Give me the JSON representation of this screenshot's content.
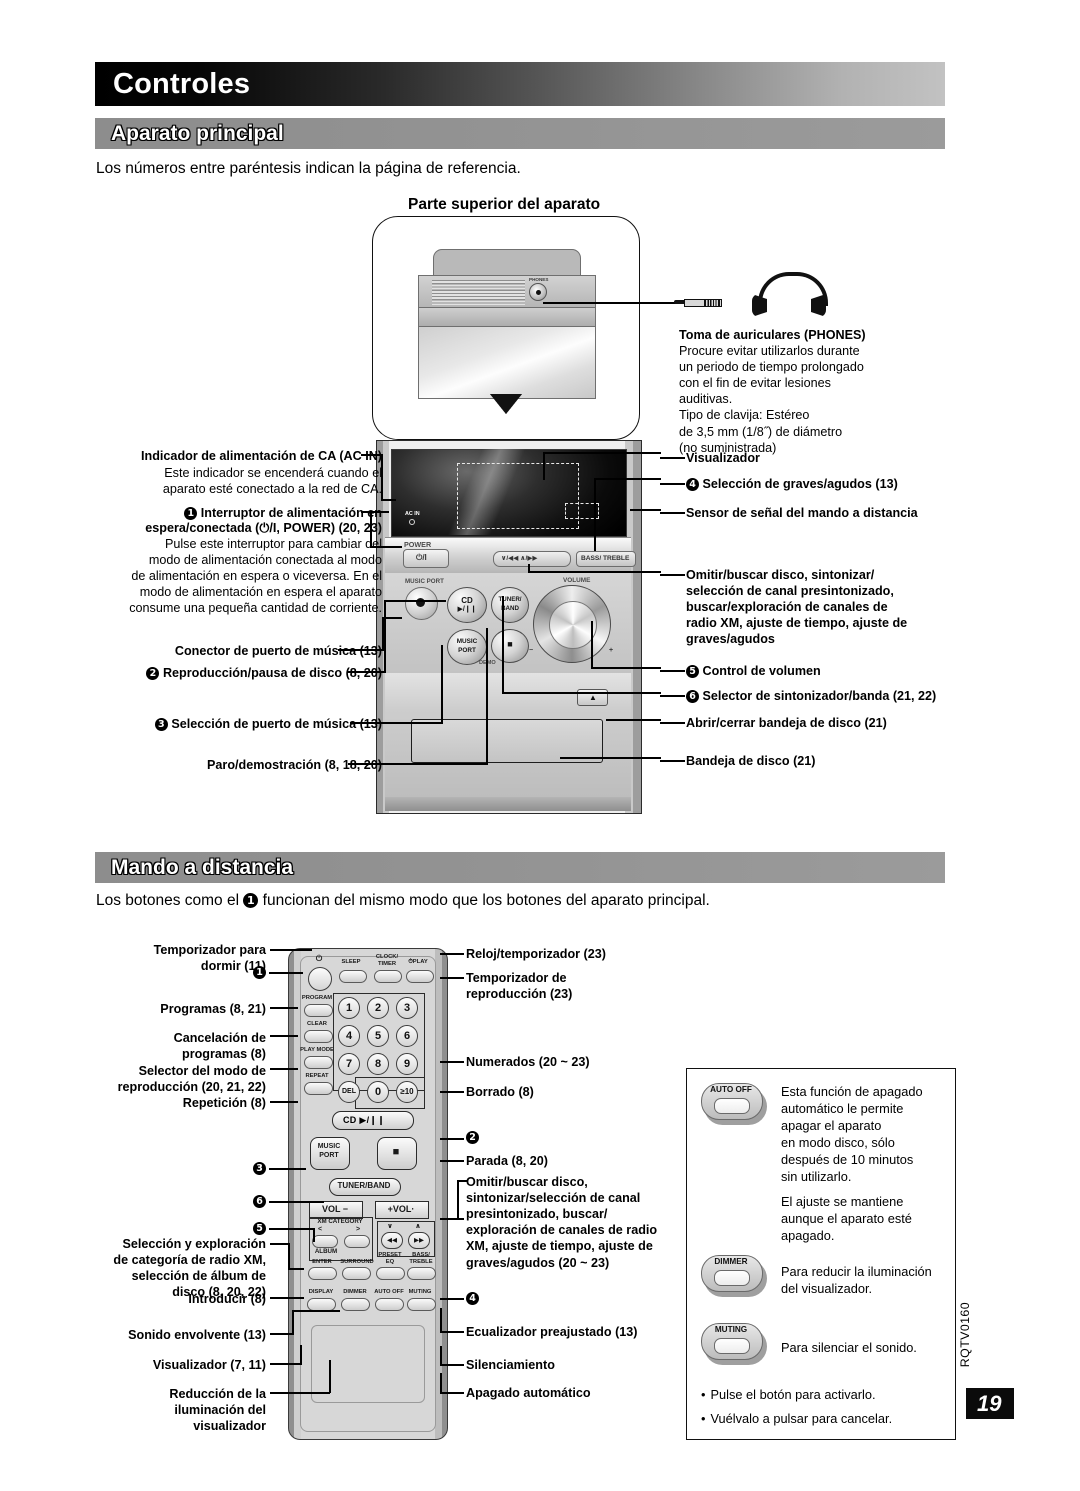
{
  "header": {
    "title": "Controles"
  },
  "sections": {
    "main_unit": {
      "heading": "Aparato principal",
      "intro": "Los números entre paréntesis indican la página de referencia.",
      "top_label": "Parte superior del aparato"
    },
    "remote": {
      "heading": "Mando a distancia",
      "intro_a": "Los botones como el ",
      "intro_num": "1",
      "intro_b": " funcionan del mismo modo que los botones del aparato principal."
    }
  },
  "phones_callout": {
    "title": "Toma de auriculares (PHONES)",
    "lines": [
      "Procure evitar utilizarlos durante",
      "un periodo de tiempo prolongado",
      "con el fin de evitar lesiones",
      "auditivas.",
      "Tipo de clavija: Estéreo",
      "de 3,5 mm (1/8˝) de diámetro",
      "(no suministrada)"
    ]
  },
  "unit_left": [
    {
      "name": "ac-in",
      "title": "Indicador de alimentación de CA (AC IN)",
      "body": [
        "Este indicador se encenderá cuando el",
        "aparato esté conectado a la red de CA."
      ]
    },
    {
      "name": "power",
      "num": "1",
      "title_l1": "Interruptor de alimentación en",
      "title_l2": "espera/conectada (⏻/I, POWER) (20, 23)",
      "body": [
        "Pulse este interruptor para cambiar del",
        "modo de alimentación conectada al modo",
        "de alimentación en espera o viceversa. En el",
        "modo de alimentación en espera el aparato",
        "consume una pequeña cantidad de corriente."
      ]
    },
    {
      "name": "music-port-jack",
      "title": "Conector de puerto de música (13)"
    },
    {
      "name": "disc-play-pause",
      "num": "2",
      "title": "Reproducción/pausa de disco (8, 20)"
    },
    {
      "name": "music-port-select",
      "num": "3",
      "title": "Selección de puerto de música (13)"
    },
    {
      "name": "stop-demo",
      "title": "Paro/demostración (8, 18, 20)"
    }
  ],
  "unit_right": [
    {
      "name": "display",
      "title": "Visualizador"
    },
    {
      "name": "bass-treble",
      "num": "4",
      "title": "Selección de graves/agudos (13)"
    },
    {
      "name": "remote-sensor",
      "title": "Sensor de señal del mando a distancia"
    },
    {
      "name": "skip-search",
      "lines": [
        "Omitir/buscar disco, sintonizar/",
        "selección de canal presintonizado,",
        "buscar/exploración de canales de",
        "radio XM, ajuste de tiempo, ajuste de",
        "graves/agudos"
      ]
    },
    {
      "name": "volume",
      "num": "5",
      "title": "Control de volumen"
    },
    {
      "name": "tuner-band",
      "num": "6",
      "title": "Selector de sintonizador/banda (21, 22)"
    },
    {
      "name": "open-close",
      "title": "Abrir/cerrar bandeja de disco (21)"
    },
    {
      "name": "disc-tray",
      "title": "Bandeja de disco (21)"
    }
  ],
  "remote_left": [
    {
      "name": "sleep",
      "lines": [
        "Temporizador para",
        "dormir (11)"
      ]
    },
    {
      "name": "power",
      "num": "1"
    },
    {
      "name": "program",
      "lines": [
        "Programas (8, 21)"
      ]
    },
    {
      "name": "clear",
      "lines": [
        "Cancelación de",
        "programas (8)"
      ]
    },
    {
      "name": "play-mode",
      "lines": [
        "Selector del modo de",
        "reproducción (20, 21, 22)"
      ]
    },
    {
      "name": "repeat",
      "lines": [
        "Repetición (8)"
      ]
    },
    {
      "name": "music-port",
      "num": "3"
    },
    {
      "name": "tuner-band",
      "num": "6"
    },
    {
      "name": "vol-minus",
      "num": "5"
    },
    {
      "name": "xm-category",
      "lines": [
        "Selección y exploración",
        "de categoría de radio XM,",
        "selección de álbum de",
        "disco (8, 20, 22)"
      ]
    },
    {
      "name": "enter",
      "lines": [
        "Introducir (8)"
      ]
    },
    {
      "name": "surround",
      "lines": [
        "Sonido envolvente (13)"
      ]
    },
    {
      "name": "display",
      "lines": [
        "Visualizador (7, 11)"
      ]
    },
    {
      "name": "dimmer",
      "lines": [
        "Reducción de la",
        "iluminación del",
        "visualizador"
      ]
    }
  ],
  "remote_right": [
    {
      "name": "clock-timer",
      "lines": [
        "Reloj/temporizador (23)"
      ]
    },
    {
      "name": "play-timer",
      "lines": [
        "Temporizador de",
        "reproducción (23)"
      ]
    },
    {
      "name": "numbered",
      "lines": [
        "Numerados (20 ~ 23)"
      ]
    },
    {
      "name": "delete",
      "lines": [
        "Borrado (8)"
      ]
    },
    {
      "name": "cd-play-pause",
      "num": "2"
    },
    {
      "name": "stop",
      "lines": [
        "Parada (8, 20)"
      ]
    },
    {
      "name": "skip-search",
      "lines": [
        "Omitir/buscar disco,",
        "sintonizar/selección de canal",
        "presintonizado, buscar/",
        "exploración de canales de radio",
        "XM, ajuste de tiempo, ajuste de",
        "graves/agudos (20 ~ 23)"
      ]
    },
    {
      "name": "bass-treble",
      "num": "4"
    },
    {
      "name": "preset-eq",
      "lines": [
        "Ecualizador preajustado (13)"
      ]
    },
    {
      "name": "muting",
      "lines": [
        "Silenciamiento"
      ]
    },
    {
      "name": "auto-off",
      "lines": [
        "Apagado automático"
      ]
    }
  ],
  "info_box": {
    "auto_off": {
      "label": "AUTO OFF",
      "p1": [
        "Esta función de apagado",
        "automático le permite",
        "apagar el aparato",
        "en modo disco, sólo",
        "después de 10 minutos",
        "sin utilizarlo."
      ],
      "p1_bold": "disco",
      "p2": [
        "El ajuste se mantiene",
        "aunque el aparato esté",
        "apagado."
      ]
    },
    "dimmer": {
      "label": "DIMMER",
      "text": [
        "Para reducir la iluminación",
        "del visualizador."
      ]
    },
    "muting": {
      "label": "MUTING",
      "text": [
        "Para silenciar el sonido."
      ]
    },
    "bullets": [
      "Pulse el botón para activarlo.",
      "Vuélvalo a pulsar para cancelar."
    ]
  },
  "unit_graphic": {
    "labels": {
      "ac_in": "AC IN",
      "power": "POWER",
      "power_btn": "⏻/I",
      "skip": "∨/◀◀      ∧/▶▶",
      "bass_treble": "BASS/ TREBLE",
      "music_port": "MUSIC PORT",
      "cd": "CD",
      "cd_sym": "▶/❙❙",
      "mp_btn_l1": "MUSIC",
      "mp_btn_l2": "PORT",
      "tuner_l1": "TUNER/",
      "tuner_l2": "BAND",
      "stop_sym": "■",
      "demo": "DEMO",
      "volume": "VOLUME",
      "vol_minus": "−",
      "vol_plus": "+",
      "eject": "▲",
      "phones": "PHONES"
    }
  },
  "remote_graphic": {
    "sleep": "SLEEP",
    "clock_l1": "CLOCK/",
    "clock_l2": "TIMER",
    "play": "⏱PLAY",
    "program": "PROGRAM",
    "clear": "CLEAR",
    "play_mode": "PLAY MODE",
    "repeat": "REPEAT",
    "keys": [
      "1",
      "2",
      "3",
      "4",
      "5",
      "6",
      "7",
      "8",
      "9"
    ],
    "del": "DEL",
    "zero": "0",
    "ten": "≥10",
    "cd": "CD ▶/❙❙",
    "mp_l1": "MUSIC",
    "mp_l2": "PORT",
    "stop": "■",
    "tuner": "TUNER/BAND",
    "vol_minus": "VOL −",
    "vol_plus": "+VOL·",
    "xm": "XM CATEGORY",
    "xm_lt": "<",
    "xm_gt": ">",
    "album": "ALBUM",
    "enter": "ENTER",
    "surround": "SURROUND",
    "sk_down": "∨",
    "sk_up": "∧",
    "sk_prev": "◀◀",
    "sk_next": "▶▶",
    "preset_l1": "PRESET",
    "preset_l2": "EQ",
    "bt_l1": "BASS/",
    "bt_l2": "TREBLE",
    "display": "DISPLAY",
    "dimmer": "DIMMER",
    "auto_off": "AUTO OFF",
    "muting": "MUTING"
  },
  "footer": {
    "doc_code": "RQTV0160",
    "page_number": "19"
  }
}
